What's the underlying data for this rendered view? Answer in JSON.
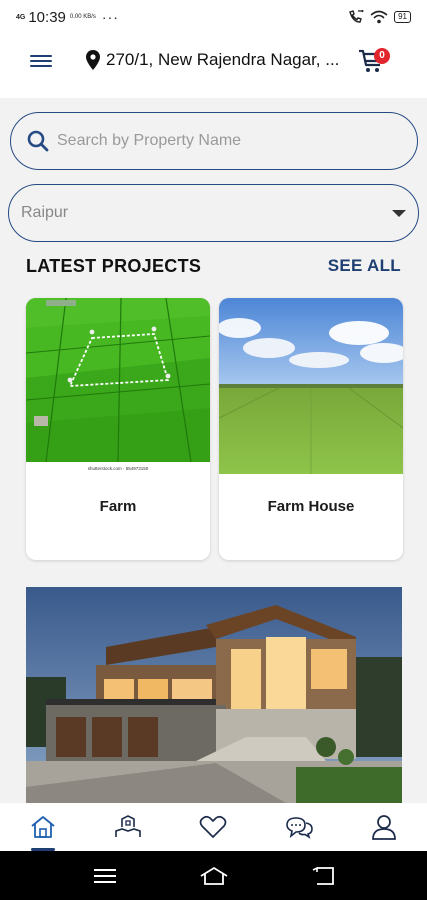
{
  "status_bar": {
    "network": "4G",
    "time": "10:39",
    "speed": "0.00 KB/s",
    "more": "···",
    "battery": "91"
  },
  "header": {
    "location": "270/1, New Rajendra Nagar, ...",
    "cart_count": "0"
  },
  "search": {
    "placeholder": "Search by Property Name"
  },
  "city_select": {
    "value": "Raipur"
  },
  "latest_projects": {
    "title": "LATEST PROJECTS",
    "see_all": "SEE ALL",
    "items": [
      {
        "name": "Farm",
        "image_caption": "shutterstock.com · 554973150"
      },
      {
        "name": "Farm House"
      }
    ]
  },
  "bottom_nav": {
    "items": [
      {
        "icon": "home-icon",
        "active": true
      },
      {
        "icon": "property-icon",
        "active": false
      },
      {
        "icon": "heart-icon",
        "active": false
      },
      {
        "icon": "chat-icon",
        "active": false
      },
      {
        "icon": "user-icon",
        "active": false
      }
    ]
  },
  "colors": {
    "primary": "#1f3f73",
    "badge": "#e3262d",
    "background": "#f2f2f2"
  }
}
